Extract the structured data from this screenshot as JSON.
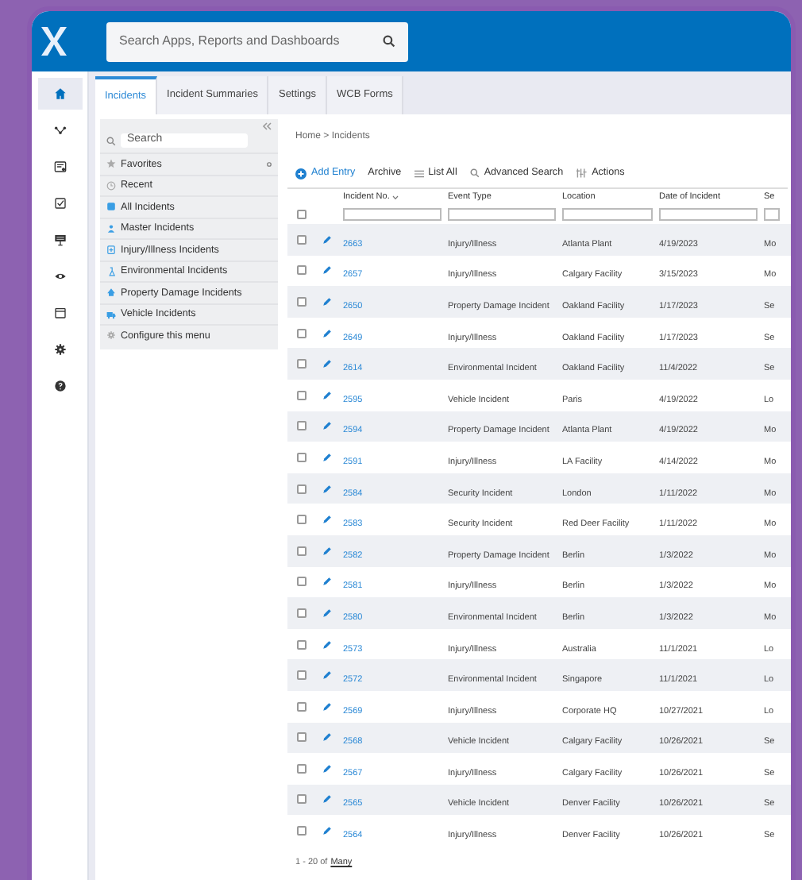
{
  "header": {
    "search": {
      "placeholder": "Search Apps, Reports and Dashboards"
    }
  },
  "rail": [
    {
      "selected": true
    },
    {
      "selected": false
    },
    {
      "selected": false
    },
    {
      "selected": false
    },
    {
      "selected": false
    },
    {
      "selected": false
    },
    {
      "selected": false
    },
    {
      "selected": false
    },
    {
      "selected": false
    }
  ],
  "tabs": [
    {
      "label": "Incidents",
      "selected": true
    },
    {
      "label": "Incident Summaries",
      "selected": false
    },
    {
      "label": "Settings",
      "selected": false
    },
    {
      "label": "WCB Forms",
      "selected": false
    }
  ],
  "menu": {
    "search": {
      "placeholder": "Search"
    },
    "items": [
      {
        "label": "Favorites"
      },
      {
        "label": "Recent"
      },
      {
        "label": "All Incidents"
      },
      {
        "label": "Master Incidents"
      },
      {
        "label": "Injury/Illness Incidents"
      },
      {
        "label": "Environmental Incidents"
      },
      {
        "label": "Property Damage Incidents"
      },
      {
        "label": "Vehicle Incidents"
      },
      {
        "label": "Configure this menu"
      }
    ]
  },
  "breadcrumb": "Home > Incidents",
  "toolbar": [
    "Add Entry",
    "Archive",
    "List All",
    "Advanced Search",
    "Actions"
  ],
  "table": {
    "columns": [
      "Incident No.",
      "Event Type",
      "Location",
      "Date of Incident",
      "Se"
    ],
    "all_checked": false,
    "rows": [
      {
        "checked": false,
        "cells": [
          "2663",
          "Injury/Illness",
          "Atlanta Plant",
          "4/19/2023",
          "Mo"
        ]
      },
      {
        "checked": false,
        "cells": [
          "2657",
          "Injury/Illness",
          "Calgary Facility",
          "3/15/2023",
          "Mo"
        ]
      },
      {
        "checked": false,
        "cells": [
          "2650",
          "Property Damage Incident",
          "Oakland Facility",
          "1/17/2023",
          "Se"
        ]
      },
      {
        "checked": false,
        "cells": [
          "2649",
          "Injury/Illness",
          "Oakland Facility",
          "1/17/2023",
          "Se"
        ]
      },
      {
        "checked": false,
        "cells": [
          "2614",
          "Environmental Incident",
          "Oakland Facility",
          "11/4/2022",
          "Se"
        ]
      },
      {
        "checked": false,
        "cells": [
          "2595",
          "Vehicle Incident",
          "Paris",
          "4/19/2022",
          "Lo"
        ]
      },
      {
        "checked": false,
        "cells": [
          "2594",
          "Property Damage Incident",
          "Atlanta Plant",
          "4/19/2022",
          "Mo"
        ]
      },
      {
        "checked": false,
        "cells": [
          "2591",
          "Injury/Illness",
          "LA Facility",
          "4/14/2022",
          "Mo"
        ]
      },
      {
        "checked": false,
        "cells": [
          "2584",
          "Security Incident",
          "London",
          "1/11/2022",
          "Mo"
        ]
      },
      {
        "checked": false,
        "cells": [
          "2583",
          "Security Incident",
          "Red Deer Facility",
          "1/11/2022",
          "Mo"
        ]
      },
      {
        "checked": false,
        "cells": [
          "2582",
          "Property Damage Incident",
          "Berlin",
          "1/3/2022",
          "Mo"
        ]
      },
      {
        "checked": false,
        "cells": [
          "2581",
          "Injury/Illness",
          "Berlin",
          "1/3/2022",
          "Mo"
        ]
      },
      {
        "checked": false,
        "cells": [
          "2580",
          "Environmental Incident",
          "Berlin",
          "1/3/2022",
          "Mo"
        ]
      },
      {
        "checked": false,
        "cells": [
          "2573",
          "Injury/Illness",
          "Australia",
          "11/1/2021",
          "Lo"
        ]
      },
      {
        "checked": false,
        "cells": [
          "2572",
          "Environmental Incident",
          "Singapore",
          "11/1/2021",
          "Lo"
        ]
      },
      {
        "checked": false,
        "cells": [
          "2569",
          "Injury/Illness",
          "Corporate HQ",
          "10/27/2021",
          "Lo"
        ]
      },
      {
        "checked": false,
        "cells": [
          "2568",
          "Vehicle Incident",
          "Calgary Facility",
          "10/26/2021",
          "Se"
        ]
      },
      {
        "checked": false,
        "cells": [
          "2567",
          "Injury/Illness",
          "Calgary Facility",
          "10/26/2021",
          "Se"
        ]
      },
      {
        "checked": false,
        "cells": [
          "2565",
          "Vehicle Incident",
          "Denver Facility",
          "10/26/2021",
          "Se"
        ]
      },
      {
        "checked": false,
        "cells": [
          "2564",
          "Injury/Illness",
          "Denver Facility",
          "10/26/2021",
          "Se"
        ]
      }
    ]
  },
  "pager": {
    "range": "1 - 20 of",
    "link": "Many"
  }
}
